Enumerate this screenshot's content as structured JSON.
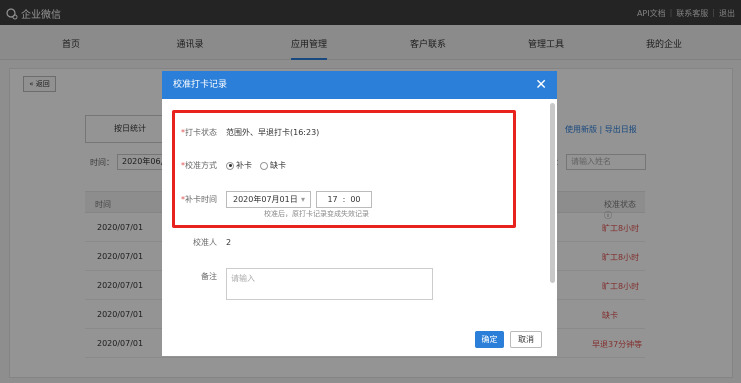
{
  "app": {
    "logo_text": "企业微信"
  },
  "top_links": [
    "API文档",
    "联系客服",
    "退出"
  ],
  "nav": [
    "首页",
    "通讯录",
    "应用管理",
    "客户联系",
    "管理工具",
    "我的企业"
  ],
  "back_label": "« 返回",
  "page": {
    "tab_label": "按日统计",
    "right_links": "使用新版 | 导出日报",
    "filter_label": "时间：",
    "filter_value": "2020年06月",
    "filter2_label": "：",
    "filter2_placeholder": "请输入姓名",
    "col_time": "时间",
    "col_status": "校准状态 ⓘ",
    "rows": [
      {
        "date": "2020/07/01",
        "status": "旷工8小时"
      },
      {
        "date": "2020/07/01",
        "status": "旷工8小时"
      },
      {
        "date": "2020/07/01",
        "status": "旷工8小时"
      },
      {
        "date": "2020/07/01",
        "status": "缺卡"
      },
      {
        "date": "2020/07/01",
        "status": "早退37分钟等"
      }
    ]
  },
  "modal": {
    "title": "校准打卡记录",
    "close": "✕",
    "status_label": "打卡状态",
    "status_value": "范围外、早退打卡(16:23)",
    "method_label": "校准方式",
    "method_options": [
      "补卡",
      "缺卡"
    ],
    "time_label": "补卡时间",
    "date_value": "2020年07月01日",
    "hour": "17",
    "minute": "00",
    "hint": "校准后，原打卡记录变成失效记录",
    "calibrator_label": "校准人",
    "calibrator_value": "2",
    "notes_label": "备注",
    "notes_placeholder": "请输入",
    "ok": "确定",
    "cancel": "取消"
  },
  "colors": {
    "accent": "#2b7fd9",
    "highlight": "#e8221d",
    "topbar": "#3e3e3e"
  }
}
